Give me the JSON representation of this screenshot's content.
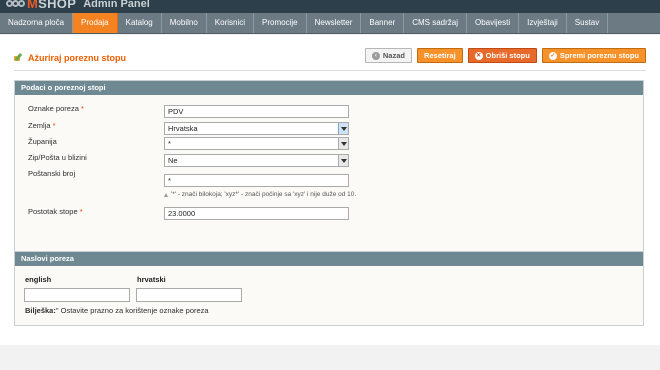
{
  "brand": {
    "logo_prefix": "M",
    "logo_text": "SHOP",
    "subtitle": "Admin Panel"
  },
  "nav": {
    "items": [
      {
        "label": "Nadzorna ploča",
        "active": false
      },
      {
        "label": "Prodaja",
        "active": true
      },
      {
        "label": "Katalog",
        "active": false
      },
      {
        "label": "Mobilno",
        "active": false
      },
      {
        "label": "Korisnici",
        "active": false
      },
      {
        "label": "Promocije",
        "active": false
      },
      {
        "label": "Newsletter",
        "active": false
      },
      {
        "label": "Banner",
        "active": false
      },
      {
        "label": "CMS sadržaj",
        "active": false
      },
      {
        "label": "Obavijesti",
        "active": false
      },
      {
        "label": "Izvještaji",
        "active": false
      },
      {
        "label": "Sustav",
        "active": false
      }
    ]
  },
  "page": {
    "title": "Ažuriraj poreznu stopu",
    "title_icon": "edit-icon"
  },
  "buttons": {
    "back": "Nazad",
    "reset": "Resetiraj",
    "delete": "Obriši stopu",
    "save": "Spremi poreznu stopu"
  },
  "section1": {
    "legend": "Podaci o poreznoj stopi",
    "fields": {
      "tax_id": {
        "label": "Oznake poreza",
        "required": "*",
        "value": "PDV"
      },
      "country": {
        "label": "Zemlja",
        "required": "*",
        "value": "Hrvatska"
      },
      "region": {
        "label": "Županija",
        "value": "*"
      },
      "zip_range": {
        "label": "Zip/Pošta u blizini",
        "value": "Ne"
      },
      "postcode": {
        "label": "Poštanski broj",
        "value": "*"
      },
      "rate": {
        "label": "Postotak stope",
        "required": "*",
        "value": "23.0000"
      }
    },
    "postcode_hint": "'*' - znači bilokoja; 'xyz*' - znači počinje sa 'xyz' i nije duže od 10."
  },
  "section2": {
    "legend": "Naslovi poreza",
    "languages": [
      {
        "label": "english",
        "value": ""
      },
      {
        "label": "hrvatski",
        "value": ""
      }
    ],
    "note_bold": "Bilješka:",
    "note_text": "\" Ostavite prazno za korištenje oznake poreza"
  },
  "colors": {
    "accent": "#f58220",
    "nav_bg": "#6b7a83",
    "legend_bg": "#6f8992",
    "title": "#eb5e00"
  }
}
